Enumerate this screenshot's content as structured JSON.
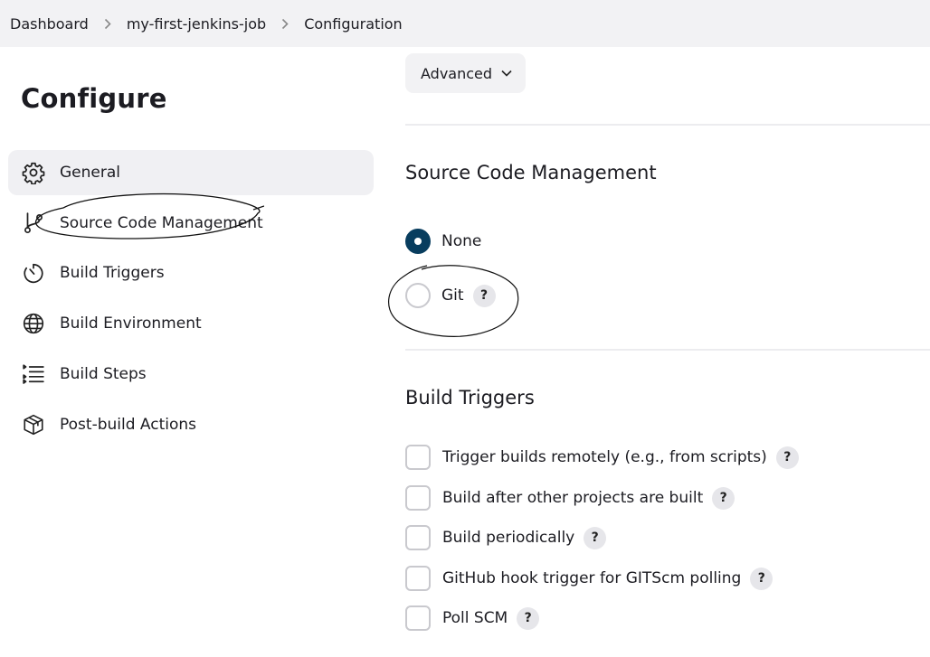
{
  "breadcrumb": {
    "items": [
      "Dashboard",
      "my-first-jenkins-job",
      "Configuration"
    ]
  },
  "page": {
    "title": "Configure"
  },
  "sidebar": {
    "items": [
      {
        "label": "General",
        "icon": "gear-icon",
        "active": true
      },
      {
        "label": "Source Code Management",
        "icon": "branch-icon",
        "active": false
      },
      {
        "label": "Build Triggers",
        "icon": "timer-icon",
        "active": false
      },
      {
        "label": "Build Environment",
        "icon": "globe-icon",
        "active": false
      },
      {
        "label": "Build Steps",
        "icon": "list-steps-icon",
        "active": false
      },
      {
        "label": "Post-build Actions",
        "icon": "package-icon",
        "active": false
      }
    ]
  },
  "advanced": {
    "label": "Advanced"
  },
  "scm": {
    "title": "Source Code Management",
    "options": [
      {
        "label": "None",
        "checked": true,
        "help": false
      },
      {
        "label": "Git",
        "checked": false,
        "help": true
      }
    ]
  },
  "triggers": {
    "title": "Build Triggers",
    "options": [
      {
        "label": "Trigger builds remotely (e.g., from scripts)",
        "checked": false
      },
      {
        "label": "Build after other projects are built",
        "checked": false
      },
      {
        "label": "Build periodically",
        "checked": false
      },
      {
        "label": "GitHub hook trigger for GITScm polling",
        "checked": false
      },
      {
        "label": "Poll SCM",
        "checked": false
      }
    ]
  },
  "help_glyph": "?",
  "colors": {
    "radio_selected": "#083d5e",
    "active_item_bg": "#f0f0f3",
    "header_bg": "#f2f2f4"
  }
}
